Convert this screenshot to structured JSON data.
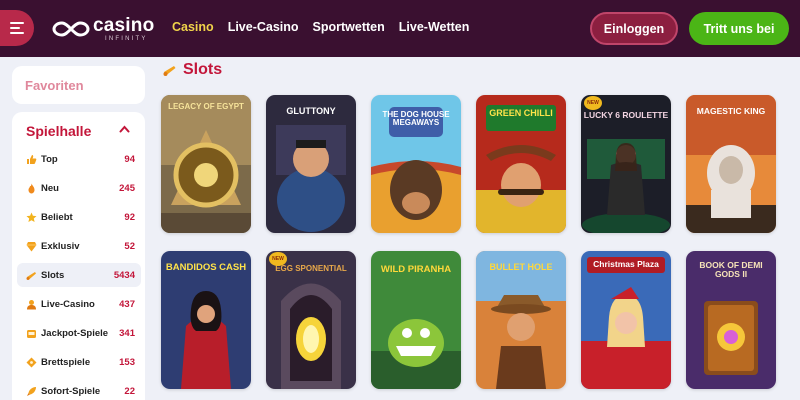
{
  "header": {
    "logo": {
      "word": "casino",
      "sub": "INFINITY"
    },
    "nav": [
      {
        "label": "Casino",
        "active": true
      },
      {
        "label": "Live-Casino",
        "active": false
      },
      {
        "label": "Sportwetten",
        "active": false
      },
      {
        "label": "Live-Wetten",
        "active": false
      }
    ],
    "login_label": "Einloggen",
    "join_label": "Tritt uns bei"
  },
  "sidebar": {
    "favorites_label": "Favoriten",
    "hall_label": "Spielhalle",
    "categories": [
      {
        "label": "Top",
        "count": "94",
        "icon": "thumbs-up-icon"
      },
      {
        "label": "Neu",
        "count": "245",
        "icon": "flame-icon"
      },
      {
        "label": "Beliebt",
        "count": "92",
        "icon": "star-icon"
      },
      {
        "label": "Exklusiv",
        "count": "52",
        "icon": "gem-icon"
      },
      {
        "label": "Slots",
        "count": "5434",
        "icon": "slot-horn-icon",
        "active": true
      },
      {
        "label": "Live-Casino",
        "count": "437",
        "icon": "croupier-icon"
      },
      {
        "label": "Jackpot-Spiele",
        "count": "341",
        "icon": "jackpot-icon"
      },
      {
        "label": "Brettspiele",
        "count": "153",
        "icon": "board-icon"
      },
      {
        "label": "Sofort-Spiele",
        "count": "22",
        "icon": "rocket-icon"
      }
    ]
  },
  "main": {
    "section_title": "Slots",
    "games": [
      {
        "title": "LEGACY OF EGYPT",
        "badge": ""
      },
      {
        "title": "GLUTTONY",
        "badge": ""
      },
      {
        "title": "THE DOG HOUSE MEGAWAYS",
        "badge": ""
      },
      {
        "title": "GREEN CHILLI",
        "badge": ""
      },
      {
        "title": "LUCKY 6 ROULETTE",
        "badge": "NEW"
      },
      {
        "title": "MAGESTIC KING",
        "badge": ""
      },
      {
        "title": "BANDIDOS CASH",
        "badge": ""
      },
      {
        "title": "EGG SPONENTIAL",
        "badge": "NEW"
      },
      {
        "title": "WILD PIRANHA",
        "badge": ""
      },
      {
        "title": "BULLET HOLE",
        "badge": ""
      },
      {
        "title": "Christmas Plaza",
        "badge": ""
      },
      {
        "title": "BOOK OF DEMI GODS II",
        "badge": ""
      }
    ]
  },
  "colors": {
    "header_bg": "#3a1030",
    "accent_red": "#c3163a",
    "nav_active": "#f0d34a",
    "join_green": "#4bb516",
    "page_bg": "#eef0f7"
  }
}
